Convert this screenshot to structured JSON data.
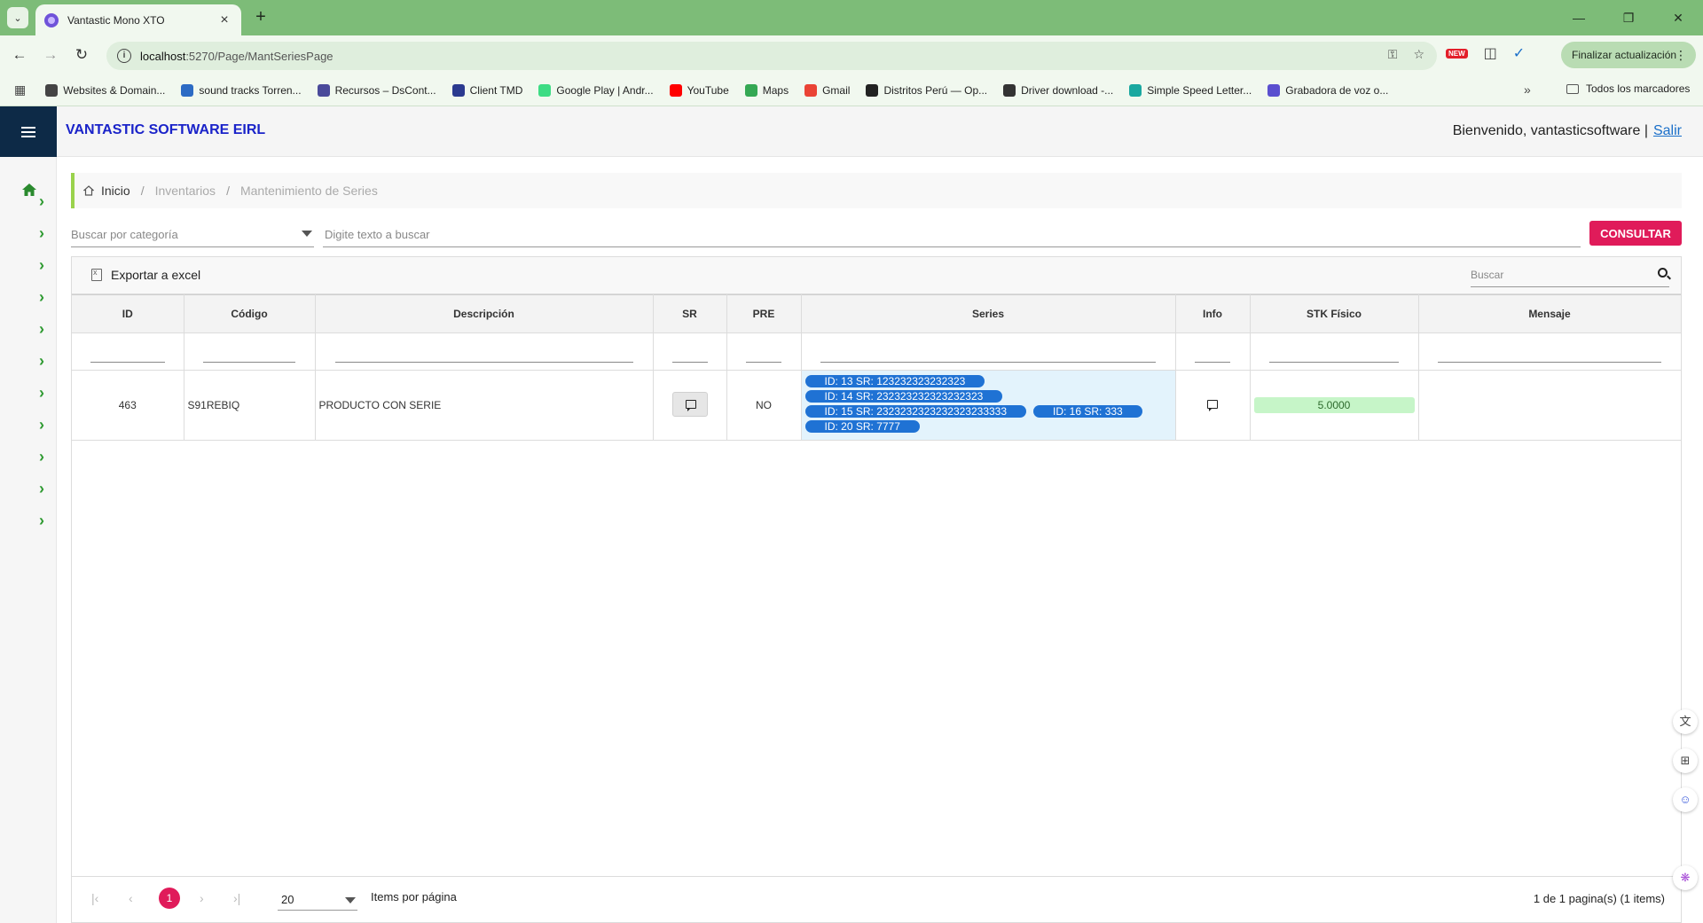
{
  "browser": {
    "tab_title": "Vantastic Mono XTO",
    "url_host": "localhost",
    "url_path": ":5270/Page/MantSeriesPage",
    "new_badge": "NEW",
    "update_button": "Finalizar actualización",
    "bookmarks": [
      {
        "label": "Websites & Domain...",
        "color": "#444444"
      },
      {
        "label": "sound tracks Torren...",
        "color": "#2c6bc4"
      },
      {
        "label": "Recursos – DsCont...",
        "color": "#4a4a9a"
      },
      {
        "label": "Client TMD",
        "color": "#2b3a8f"
      },
      {
        "label": "Google Play  |  Andr...",
        "color": "#3ddc84"
      },
      {
        "label": "YouTube",
        "color": "#ff0000"
      },
      {
        "label": "Maps",
        "color": "#34a853"
      },
      {
        "label": "Gmail",
        "color": "#ea4335"
      },
      {
        "label": "Distritos Perú — Op...",
        "color": "#222222"
      },
      {
        "label": "Driver download -...",
        "color": "#333333"
      },
      {
        "label": "Simple Speed Letter...",
        "color": "#1aa8a0"
      },
      {
        "label": "Grabadora de voz o...",
        "color": "#5a4fcf"
      }
    ],
    "all_bookmarks": "Todos los marcadores"
  },
  "app": {
    "brand": "VANTASTIC SOFTWARE EIRL",
    "welcome": "Bienvenido, vantasticsoftware |",
    "logout": "Salir",
    "accent_color": "#e01b5a",
    "brand_color": "#1a23c9"
  },
  "breadcrumb": {
    "home": "Inicio",
    "section": "Inventarios",
    "page": "Mantenimiento de Series"
  },
  "filters": {
    "category_placeholder": "Buscar por categoría",
    "text_placeholder": "Digite texto a buscar",
    "consultar": "CONSULTAR"
  },
  "grid": {
    "export": "Exportar a excel",
    "search_placeholder": "Buscar",
    "columns": [
      "ID",
      "Código",
      "Descripción",
      "SR",
      "PRE",
      "Series",
      "Info",
      "STK Físico",
      "Mensaje"
    ],
    "rows": [
      {
        "id": "463",
        "codigo": "S91REBIQ",
        "descripcion": "PRODUCTO CON SERIE",
        "pre": "NO",
        "series": [
          "ID: 13 SR: 123232323232323",
          "ID: 14 SR: 232323232323232323",
          "ID: 15 SR: 2323232323232323233333",
          "ID: 16 SR: 333",
          "ID: 20 SR: 7777"
        ],
        "stk_fisico": "5.0000",
        "mensaje": ""
      }
    ]
  },
  "pager": {
    "current_page": "1",
    "page_size": "20",
    "items_label": "Items por página",
    "summary": "1 de 1 pagina(s) (1 items)"
  }
}
